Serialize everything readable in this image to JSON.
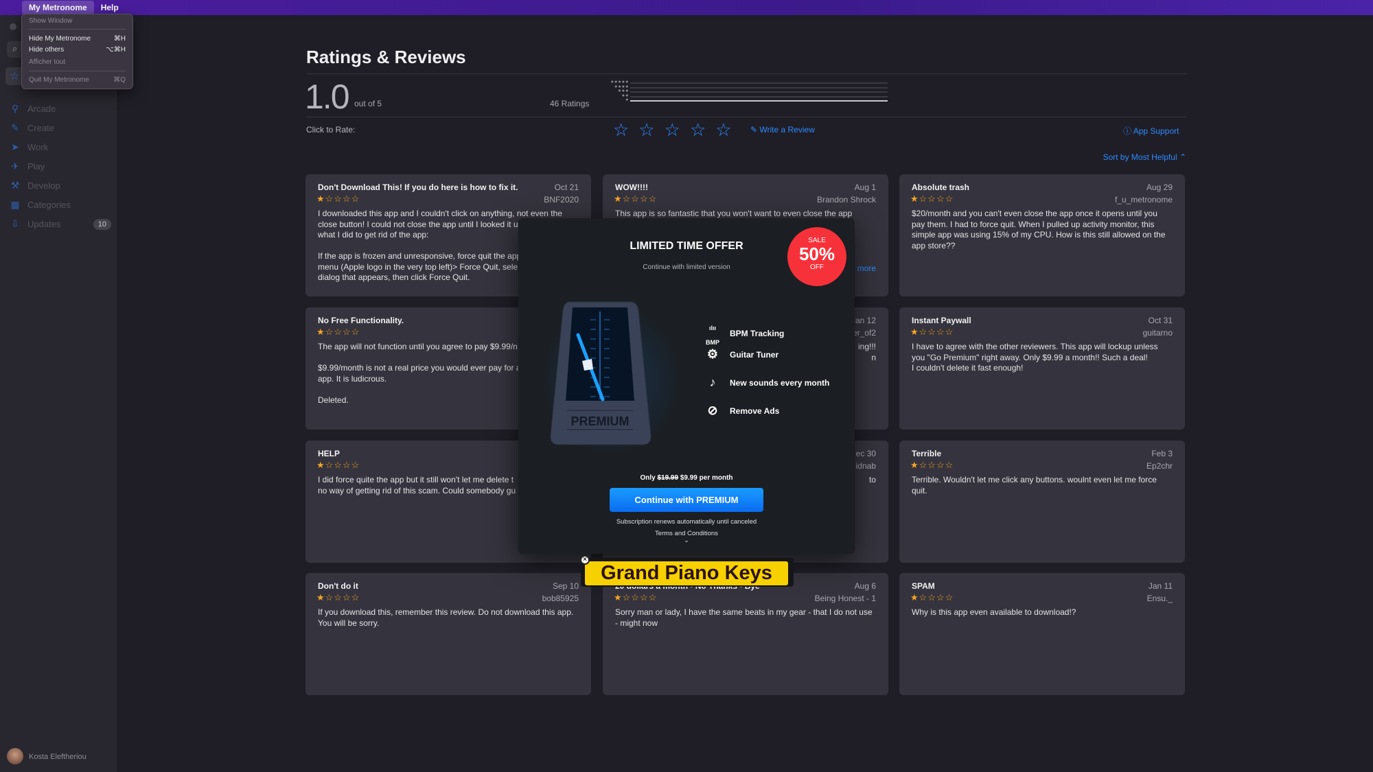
{
  "menubar": {
    "app": "My Metronome",
    "help": "Help"
  },
  "app_menu": {
    "items": [
      {
        "label": "Show Window",
        "shortcut": "",
        "enabled": false
      },
      {
        "label": "Hide My Metronome",
        "shortcut": "⌘H",
        "enabled": true
      },
      {
        "label": "Hide others",
        "shortcut": "⌥⌘H",
        "enabled": true
      },
      {
        "label": "Afficher tout",
        "shortcut": "",
        "enabled": false
      },
      {
        "label": "Quit My Metronome",
        "shortcut": "⌘Q",
        "enabled": false
      }
    ]
  },
  "sidebar": {
    "items": [
      {
        "label": "Arcade",
        "icon": "joystick-icon"
      },
      {
        "label": "Create",
        "icon": "brush-icon"
      },
      {
        "label": "Work",
        "icon": "paper-plane-icon"
      },
      {
        "label": "Play",
        "icon": "rocket-icon"
      },
      {
        "label": "Develop",
        "icon": "hammer-icon"
      },
      {
        "label": "Categories",
        "icon": "grid-icon"
      },
      {
        "label": "Updates",
        "icon": "download-icon",
        "badge": "10"
      }
    ],
    "user": "Kosta Eleftheriou"
  },
  "main": {
    "title": "Ratings & Reviews",
    "rating": "1.0",
    "out_of": "out of 5",
    "ratings_count": "46 Ratings",
    "histogram": [
      {
        "stars": "★★★★★",
        "fraction": 0
      },
      {
        "stars": "★★★★",
        "fraction": 0
      },
      {
        "stars": "★★★",
        "fraction": 0
      },
      {
        "stars": "★★",
        "fraction": 0
      },
      {
        "stars": "★",
        "fraction": 1
      }
    ],
    "click_to_rate": "Click to Rate:",
    "write_review": "Write a Review",
    "app_support": "App Support",
    "sort": "Sort by Most Helpful ⌃"
  },
  "reviews": [
    {
      "title": "Don't Download This! If you do here is how to fix it.",
      "date": "Oct 21",
      "author": "BNF2020",
      "stars": 1,
      "body": "I downloaded this app and I couldn't click on anything, not even the\nclose button! I could not close the app until I looked it u\nwhat I did to get rid of the app:\n\nIf the app is frozen and unresponsive, force quit the app\nmenu (Apple logo in the very top left)> Force Quit, sele\ndialog that appears, then click Force Quit."
    },
    {
      "title": "WOW!!!!",
      "date": "Aug 1",
      "author": "Brandon Shrock",
      "stars": 1,
      "body": "This app is so fantastic that you won't want to even close the app\n                                                                                  n't let\n                                                                                  of",
      "more": "more"
    },
    {
      "title": "Absolute trash",
      "date": "Aug 29",
      "author": "f_u_metronome",
      "stars": 1,
      "body": "$20/month and you can't even close the app once it opens until you pay them. I had to force quit. When I pulled up activity monitor, this simple app was using 15% of my CPU. How is this still allowed on the app store??"
    },
    {
      "title": "No Free Functionality.",
      "date": "",
      "author": "",
      "stars": 1,
      "body": "The app will not function until you agree to pay $9.99/n\n\n$9.99/month is not a real price you would ever pay for a\napp. It is ludicrous.\n\nDeleted."
    },
    {
      "title": "",
      "date": "Jan 12",
      "author": "er_of2",
      "stars": 0,
      "body": "ing!!!\nn",
      "right": true
    },
    {
      "title": "Instant Paywall",
      "date": "Oct 31",
      "author": "guitarno",
      "stars": 1,
      "body": "I have to agree with the other reviewers. This app will lockup unless you \"Go Premium\" right away. Only $9.99 a month!! Such a deal!\nI couldn't delete it fast enough!"
    },
    {
      "title": "HELP",
      "date": "",
      "author": "",
      "stars": 1,
      "body": "I did force quite the app but it still won't let me delete t\nno way of getting rid of this scam. Could somebody gu"
    },
    {
      "title": "",
      "date": "ec 30",
      "author": "idnab",
      "stars": 0,
      "body": "to",
      "right": true
    },
    {
      "title": "Terrible",
      "date": "Feb 3",
      "author": "Ep2chr",
      "stars": 1,
      "body": "Terrible. Wouldn't let me click any buttons. woulnt even let me force quit."
    },
    {
      "title": "Don't do it",
      "date": "Sep 10",
      "author": "bob85925",
      "stars": 1,
      "body": "If you download this, remember this review. Do not download this app. You will be sorry."
    },
    {
      "title": "20 dollars a month - No Thanks - Bye",
      "date": "Aug 6",
      "author": "Being Honest - 1",
      "stars": 1,
      "body": "Sorry man or lady, I have the same beats in my gear - that I do not use - might now"
    },
    {
      "title": "SPAM",
      "date": "Jan 11",
      "author": "Ensu._",
      "stars": 1,
      "body": "Why is this app even available to download!?"
    }
  ],
  "paywall": {
    "title": "LIMITED TIME OFFER",
    "subtitle": "Continue with limited version",
    "sale": "SALE",
    "percent": "50%",
    "off": "OFF",
    "art_label": "PREMIUM",
    "features": [
      {
        "label": "BPM Tracking",
        "icon": "bpm-icon"
      },
      {
        "label": "Guitar Tuner",
        "icon": "guitar-headstock-icon"
      },
      {
        "label": "New sounds every month",
        "icon": "music-note-icon"
      },
      {
        "label": "Remove Ads",
        "icon": "no-ads-icon"
      }
    ],
    "price_prefix": "Only",
    "old_price": "$19.99",
    "new_price": "$9.99 per month",
    "cta": "Continue with PREMIUM",
    "renew": "Subscription renews automatically until canceled",
    "terms": "Terms and Conditions",
    "accent": "#0a84ff",
    "sale_color": "#f7313a"
  },
  "overlay_label": {
    "text": "Grand Piano Keys",
    "color": "#f7d000"
  }
}
